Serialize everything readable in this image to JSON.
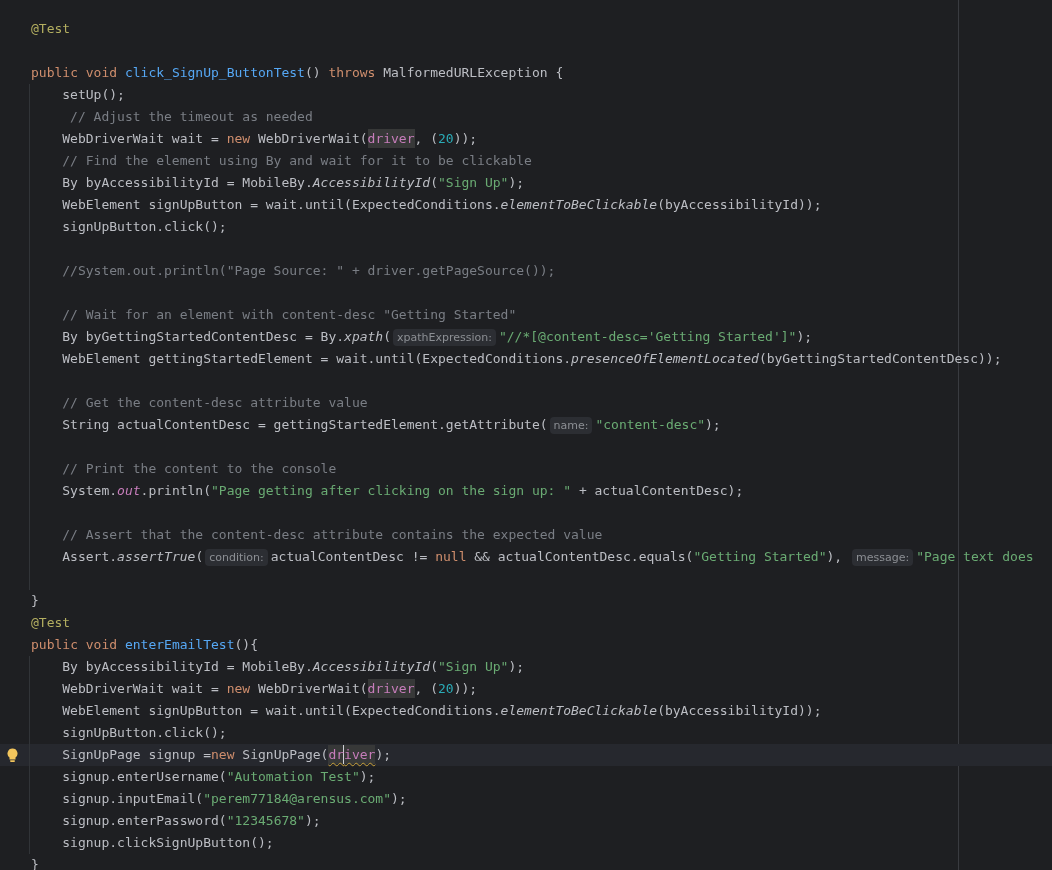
{
  "lines": [
    {
      "kind": "code",
      "tokens": [
        {
          "kind": "annotation",
          "text": "@Test"
        }
      ]
    },
    {
      "kind": "blank"
    },
    {
      "kind": "code",
      "tokens": [
        {
          "kind": "keyword",
          "text": "public void "
        },
        {
          "kind": "declaration",
          "text": "click_SignUp_ButtonTest"
        },
        {
          "kind": "plain",
          "text": "() "
        },
        {
          "kind": "keyword",
          "text": "throws "
        },
        {
          "kind": "plain",
          "text": "MalformedURLException {"
        }
      ],
      "children": [
        {
          "kind": "code",
          "tokens": [
            {
              "kind": "plain",
              "text": "setUp();"
            }
          ]
        },
        {
          "kind": "code",
          "tokens": [
            {
              "kind": "comment",
              "text": " // Adjust the timeout as needed"
            }
          ]
        },
        {
          "kind": "code",
          "tokens": [
            {
              "kind": "plain",
              "text": "WebDriverWait wait = "
            },
            {
              "kind": "keyword",
              "text": "new "
            },
            {
              "kind": "plain",
              "text": "WebDriverWait("
            },
            {
              "kind": "parameter",
              "text": "driver"
            },
            {
              "kind": "plain",
              "text": ", ("
            },
            {
              "kind": "number",
              "text": "20"
            },
            {
              "kind": "plain",
              "text": "));"
            }
          ]
        },
        {
          "kind": "code",
          "tokens": [
            {
              "kind": "comment",
              "text": "// Find the element using By and wait for it to be clickable"
            }
          ]
        },
        {
          "kind": "code",
          "tokens": [
            {
              "kind": "plain",
              "text": "By byAccessibilityId = MobileBy."
            },
            {
              "kind": "static_call",
              "text": "AccessibilityId"
            },
            {
              "kind": "plain",
              "text": "("
            },
            {
              "kind": "string",
              "text": "\"Sign Up\""
            },
            {
              "kind": "plain",
              "text": ");"
            }
          ]
        },
        {
          "kind": "code",
          "tokens": [
            {
              "kind": "plain",
              "text": "WebElement signUpButton = wait.until(ExpectedConditions."
            },
            {
              "kind": "static_call",
              "text": "elementToBeClickable"
            },
            {
              "kind": "plain",
              "text": "(byAccessibilityId));"
            }
          ]
        },
        {
          "kind": "code",
          "tokens": [
            {
              "kind": "plain",
              "text": "signUpButton.click();"
            }
          ]
        },
        {
          "kind": "blank"
        },
        {
          "kind": "code",
          "tokens": [
            {
              "kind": "comment",
              "text": "//System.out.println(\"Page Source: \" + driver.getPageSource());"
            }
          ]
        },
        {
          "kind": "blank"
        },
        {
          "kind": "code",
          "tokens": [
            {
              "kind": "comment",
              "text": "// Wait for an element with content-desc \"Getting Started\""
            }
          ]
        },
        {
          "kind": "code",
          "tokens": [
            {
              "kind": "plain",
              "text": "By byGettingStartedContentDesc = By."
            },
            {
              "kind": "static_call",
              "text": "xpath"
            },
            {
              "kind": "plain",
              "text": "("
            },
            {
              "kind": "hint",
              "text": "xpathExpression:"
            },
            {
              "kind": "string",
              "text": "\"//*[@content-desc='Getting Started']\""
            },
            {
              "kind": "plain",
              "text": ");"
            }
          ]
        },
        {
          "kind": "code",
          "tokens": [
            {
              "kind": "plain",
              "text": "WebElement gettingStartedElement = wait.until(ExpectedConditions."
            },
            {
              "kind": "static_call",
              "text": "presenceOfElementLocated"
            },
            {
              "kind": "plain",
              "text": "(byGettingStartedContentDesc));"
            }
          ]
        },
        {
          "kind": "blank"
        },
        {
          "kind": "code",
          "tokens": [
            {
              "kind": "comment",
              "text": "// Get the content-desc attribute value"
            }
          ]
        },
        {
          "kind": "code",
          "tokens": [
            {
              "kind": "plain",
              "text": "String actualContentDesc = gettingStartedElement.getAttribute("
            },
            {
              "kind": "hint",
              "text": "name:"
            },
            {
              "kind": "string",
              "text": "\"content-desc\""
            },
            {
              "kind": "plain",
              "text": ");"
            }
          ]
        },
        {
          "kind": "blank"
        },
        {
          "kind": "code",
          "tokens": [
            {
              "kind": "comment",
              "text": "// Print the content to the console"
            }
          ]
        },
        {
          "kind": "code",
          "tokens": [
            {
              "kind": "plain",
              "text": "System."
            },
            {
              "kind": "field",
              "text": "out"
            },
            {
              "kind": "plain",
              "text": ".println("
            },
            {
              "kind": "string",
              "text": "\"Page getting after clicking on the sign up: \""
            },
            {
              "kind": "plain",
              "text": " + actualContentDesc);"
            }
          ]
        },
        {
          "kind": "blank"
        },
        {
          "kind": "code",
          "tokens": [
            {
              "kind": "comment",
              "text": "// Assert that the content-desc attribute contains the expected value"
            }
          ]
        },
        {
          "kind": "code",
          "tokens": [
            {
              "kind": "plain",
              "text": "Assert."
            },
            {
              "kind": "static_call",
              "text": "assertTrue"
            },
            {
              "kind": "plain",
              "text": "("
            },
            {
              "kind": "hint",
              "text": "condition:"
            },
            {
              "kind": "plain",
              "text": "actualContentDesc != "
            },
            {
              "kind": "keyword",
              "text": "null"
            },
            {
              "kind": "plain",
              "text": " && actualContentDesc.equals("
            },
            {
              "kind": "string",
              "text": "\"Getting Started\""
            },
            {
              "kind": "plain",
              "text": "), "
            },
            {
              "kind": "hint",
              "text": "message:"
            },
            {
              "kind": "string",
              "text": "\"Page text does"
            }
          ]
        },
        {
          "kind": "blank"
        }
      ]
    },
    {
      "kind": "code",
      "tokens": [
        {
          "kind": "plain",
          "text": "}"
        }
      ]
    },
    {
      "kind": "code",
      "tokens": [
        {
          "kind": "annotation",
          "text": "@Test"
        }
      ]
    },
    {
      "kind": "code",
      "tokens": [
        {
          "kind": "keyword",
          "text": "public void "
        },
        {
          "kind": "declaration",
          "text": "enterEmailTest"
        },
        {
          "kind": "plain",
          "text": "(){"
        }
      ],
      "children": [
        {
          "kind": "code",
          "tokens": [
            {
              "kind": "plain",
              "text": "By byAccessibilityId = MobileBy."
            },
            {
              "kind": "static_call",
              "text": "AccessibilityId"
            },
            {
              "kind": "plain",
              "text": "("
            },
            {
              "kind": "string",
              "text": "\"Sign Up\""
            },
            {
              "kind": "plain",
              "text": ");"
            }
          ]
        },
        {
          "kind": "code",
          "tokens": [
            {
              "kind": "plain",
              "text": "WebDriverWait wait = "
            },
            {
              "kind": "keyword",
              "text": "new "
            },
            {
              "kind": "plain",
              "text": "WebDriverWait("
            },
            {
              "kind": "parameter",
              "text": "driver"
            },
            {
              "kind": "plain",
              "text": ", ("
            },
            {
              "kind": "number",
              "text": "20"
            },
            {
              "kind": "plain",
              "text": "));"
            }
          ]
        },
        {
          "kind": "code",
          "tokens": [
            {
              "kind": "plain",
              "text": "WebElement signUpButton = wait.until(ExpectedConditions."
            },
            {
              "kind": "static_call",
              "text": "elementToBeClickable"
            },
            {
              "kind": "plain",
              "text": "(byAccessibilityId));"
            }
          ]
        },
        {
          "kind": "code",
          "tokens": [
            {
              "kind": "plain",
              "text": "signUpButton.click();"
            }
          ]
        },
        {
          "kind": "code",
          "current": true,
          "intention": true,
          "tokens": [
            {
              "kind": "plain",
              "text": "SignUpPage signup ="
            },
            {
              "kind": "keyword",
              "text": "new "
            },
            {
              "kind": "plain",
              "text": "SignUpPage("
            },
            {
              "kind": "parameter",
              "text": "dr",
              "warning": true,
              "caret": true
            },
            {
              "kind": "parameter",
              "text": "iver",
              "warning": true
            },
            {
              "kind": "plain",
              "text": ");"
            }
          ]
        },
        {
          "kind": "code",
          "tokens": [
            {
              "kind": "plain",
              "text": "signup.enterUsername("
            },
            {
              "kind": "string",
              "text": "\"Automation Test\""
            },
            {
              "kind": "plain",
              "text": ");"
            }
          ]
        },
        {
          "kind": "code",
          "tokens": [
            {
              "kind": "plain",
              "text": "signup.inputEmail("
            },
            {
              "kind": "string",
              "text": "\"perem77184@arensus.com\""
            },
            {
              "kind": "plain",
              "text": ");"
            }
          ]
        },
        {
          "kind": "code",
          "tokens": [
            {
              "kind": "plain",
              "text": "signup.enterPassword("
            },
            {
              "kind": "string",
              "text": "\"12345678\""
            },
            {
              "kind": "plain",
              "text": ");"
            }
          ]
        },
        {
          "kind": "code",
          "tokens": [
            {
              "kind": "plain",
              "text": "signup.clickSignUpButton();"
            }
          ]
        }
      ]
    },
    {
      "kind": "code",
      "tokens": [
        {
          "kind": "plain",
          "text": "}"
        }
      ]
    }
  ]
}
